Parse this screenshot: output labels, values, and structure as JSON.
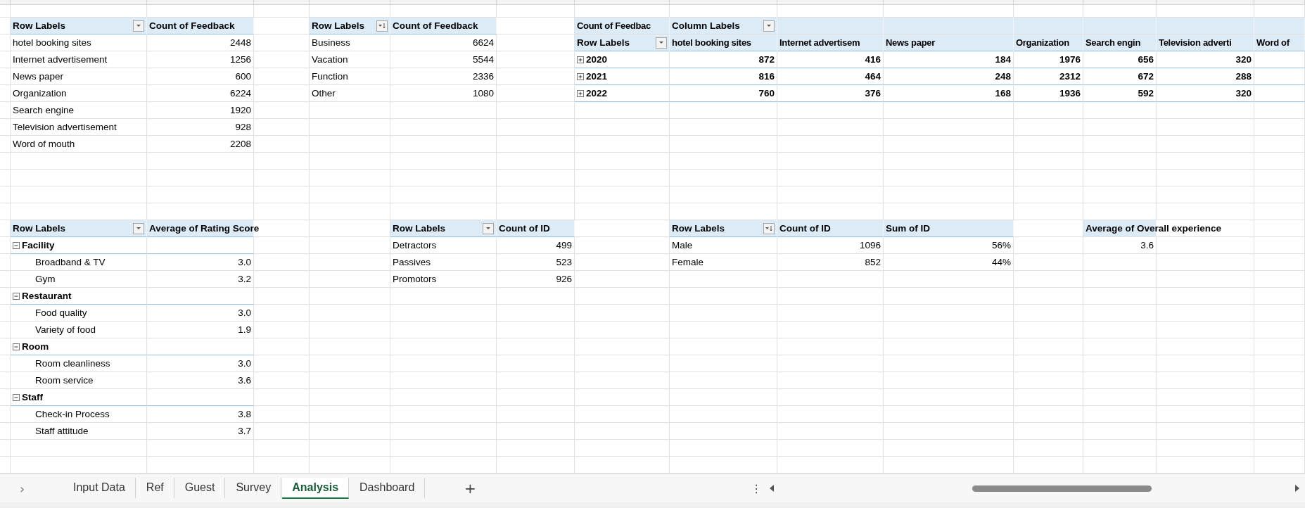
{
  "pivots": [
    {
      "kind": "list",
      "columns": [
        "Row Labels",
        "Count of Feedback"
      ],
      "sorted": false,
      "rows": [
        {
          "label": "hotel booking sites",
          "values": [
            "2448"
          ]
        },
        {
          "label": "Internet advertisement",
          "values": [
            "1256"
          ]
        },
        {
          "label": "News paper",
          "values": [
            "600"
          ]
        },
        {
          "label": "Organization",
          "values": [
            "6224"
          ]
        },
        {
          "label": "Search engine",
          "values": [
            "1920"
          ]
        },
        {
          "label": "Television advertisement",
          "values": [
            "928"
          ]
        },
        {
          "label": "Word of mouth",
          "values": [
            "2208"
          ]
        }
      ]
    },
    {
      "kind": "list",
      "columns": [
        "Row Labels",
        "Count of Feedback"
      ],
      "sorted": true,
      "rows": [
        {
          "label": "Business",
          "values": [
            "6624"
          ]
        },
        {
          "label": "Vacation",
          "values": [
            "5544"
          ]
        },
        {
          "label": "Function",
          "values": [
            "2336"
          ]
        },
        {
          "label": "Other",
          "values": [
            "1080"
          ]
        }
      ]
    },
    {
      "kind": "crosstab",
      "value_field": "Count of Feedbac",
      "column_field": "Column Labels",
      "row_field": "Row Labels",
      "sorted": false,
      "categories": [
        "hotel booking sites",
        "Internet advertisem",
        "News paper",
        "Organization",
        "Search engin",
        "Television adverti",
        "Word of"
      ],
      "rows": [
        {
          "label": "2020",
          "expanded": false,
          "values": [
            "872",
            "416",
            "184",
            "1976",
            "656",
            "320"
          ]
        },
        {
          "label": "2021",
          "expanded": false,
          "values": [
            "816",
            "464",
            "248",
            "2312",
            "672",
            "288"
          ]
        },
        {
          "label": "2022",
          "expanded": false,
          "values": [
            "760",
            "376",
            "168",
            "1936",
            "592",
            "320"
          ]
        }
      ]
    },
    {
      "kind": "grouped",
      "columns": [
        "Row Labels",
        "Average of Rating Score"
      ],
      "sorted": false,
      "groups": [
        {
          "label": "Facility",
          "expanded": true,
          "children": [
            {
              "label": "Broadband & TV",
              "value": "3.0"
            },
            {
              "label": "Gym",
              "value": "3.2"
            }
          ]
        },
        {
          "label": "Restaurant",
          "expanded": true,
          "children": [
            {
              "label": "Food quality",
              "value": "3.0"
            },
            {
              "label": "Variety of food",
              "value": "1.9"
            }
          ]
        },
        {
          "label": "Room",
          "expanded": true,
          "children": [
            {
              "label": "Room cleanliness",
              "value": "3.0"
            },
            {
              "label": "Room service",
              "value": "3.6"
            }
          ]
        },
        {
          "label": "Staff",
          "expanded": true,
          "children": [
            {
              "label": "Check-in Process",
              "value": "3.8"
            },
            {
              "label": "Staff attitude",
              "value": "3.7"
            }
          ]
        }
      ]
    },
    {
      "kind": "list",
      "columns": [
        "Row Labels",
        "Count of ID"
      ],
      "sorted": false,
      "rows": [
        {
          "label": "Detractors",
          "values": [
            "499"
          ]
        },
        {
          "label": "Passives",
          "values": [
            "523"
          ]
        },
        {
          "label": "Promotors",
          "values": [
            "926"
          ]
        }
      ]
    },
    {
      "kind": "list",
      "columns": [
        "Row Labels",
        "Count of ID",
        "Sum of ID"
      ],
      "sorted": true,
      "rows": [
        {
          "label": "Male",
          "values": [
            "1096",
            "56%"
          ]
        },
        {
          "label": "Female",
          "values": [
            "852",
            "44%"
          ]
        }
      ]
    },
    {
      "kind": "single",
      "header": "Average of Overall experience",
      "value": "3.6"
    }
  ],
  "sheet_tabs": {
    "nav": "›",
    "add": "+",
    "menu": "⋮",
    "tabs": [
      {
        "label": "Input Data",
        "selected": false
      },
      {
        "label": "Ref",
        "selected": false
      },
      {
        "label": "Guest",
        "selected": false
      },
      {
        "label": "Survey",
        "selected": false
      },
      {
        "label": "Analysis",
        "selected": true
      },
      {
        "label": "Dashboard",
        "selected": false
      }
    ]
  }
}
